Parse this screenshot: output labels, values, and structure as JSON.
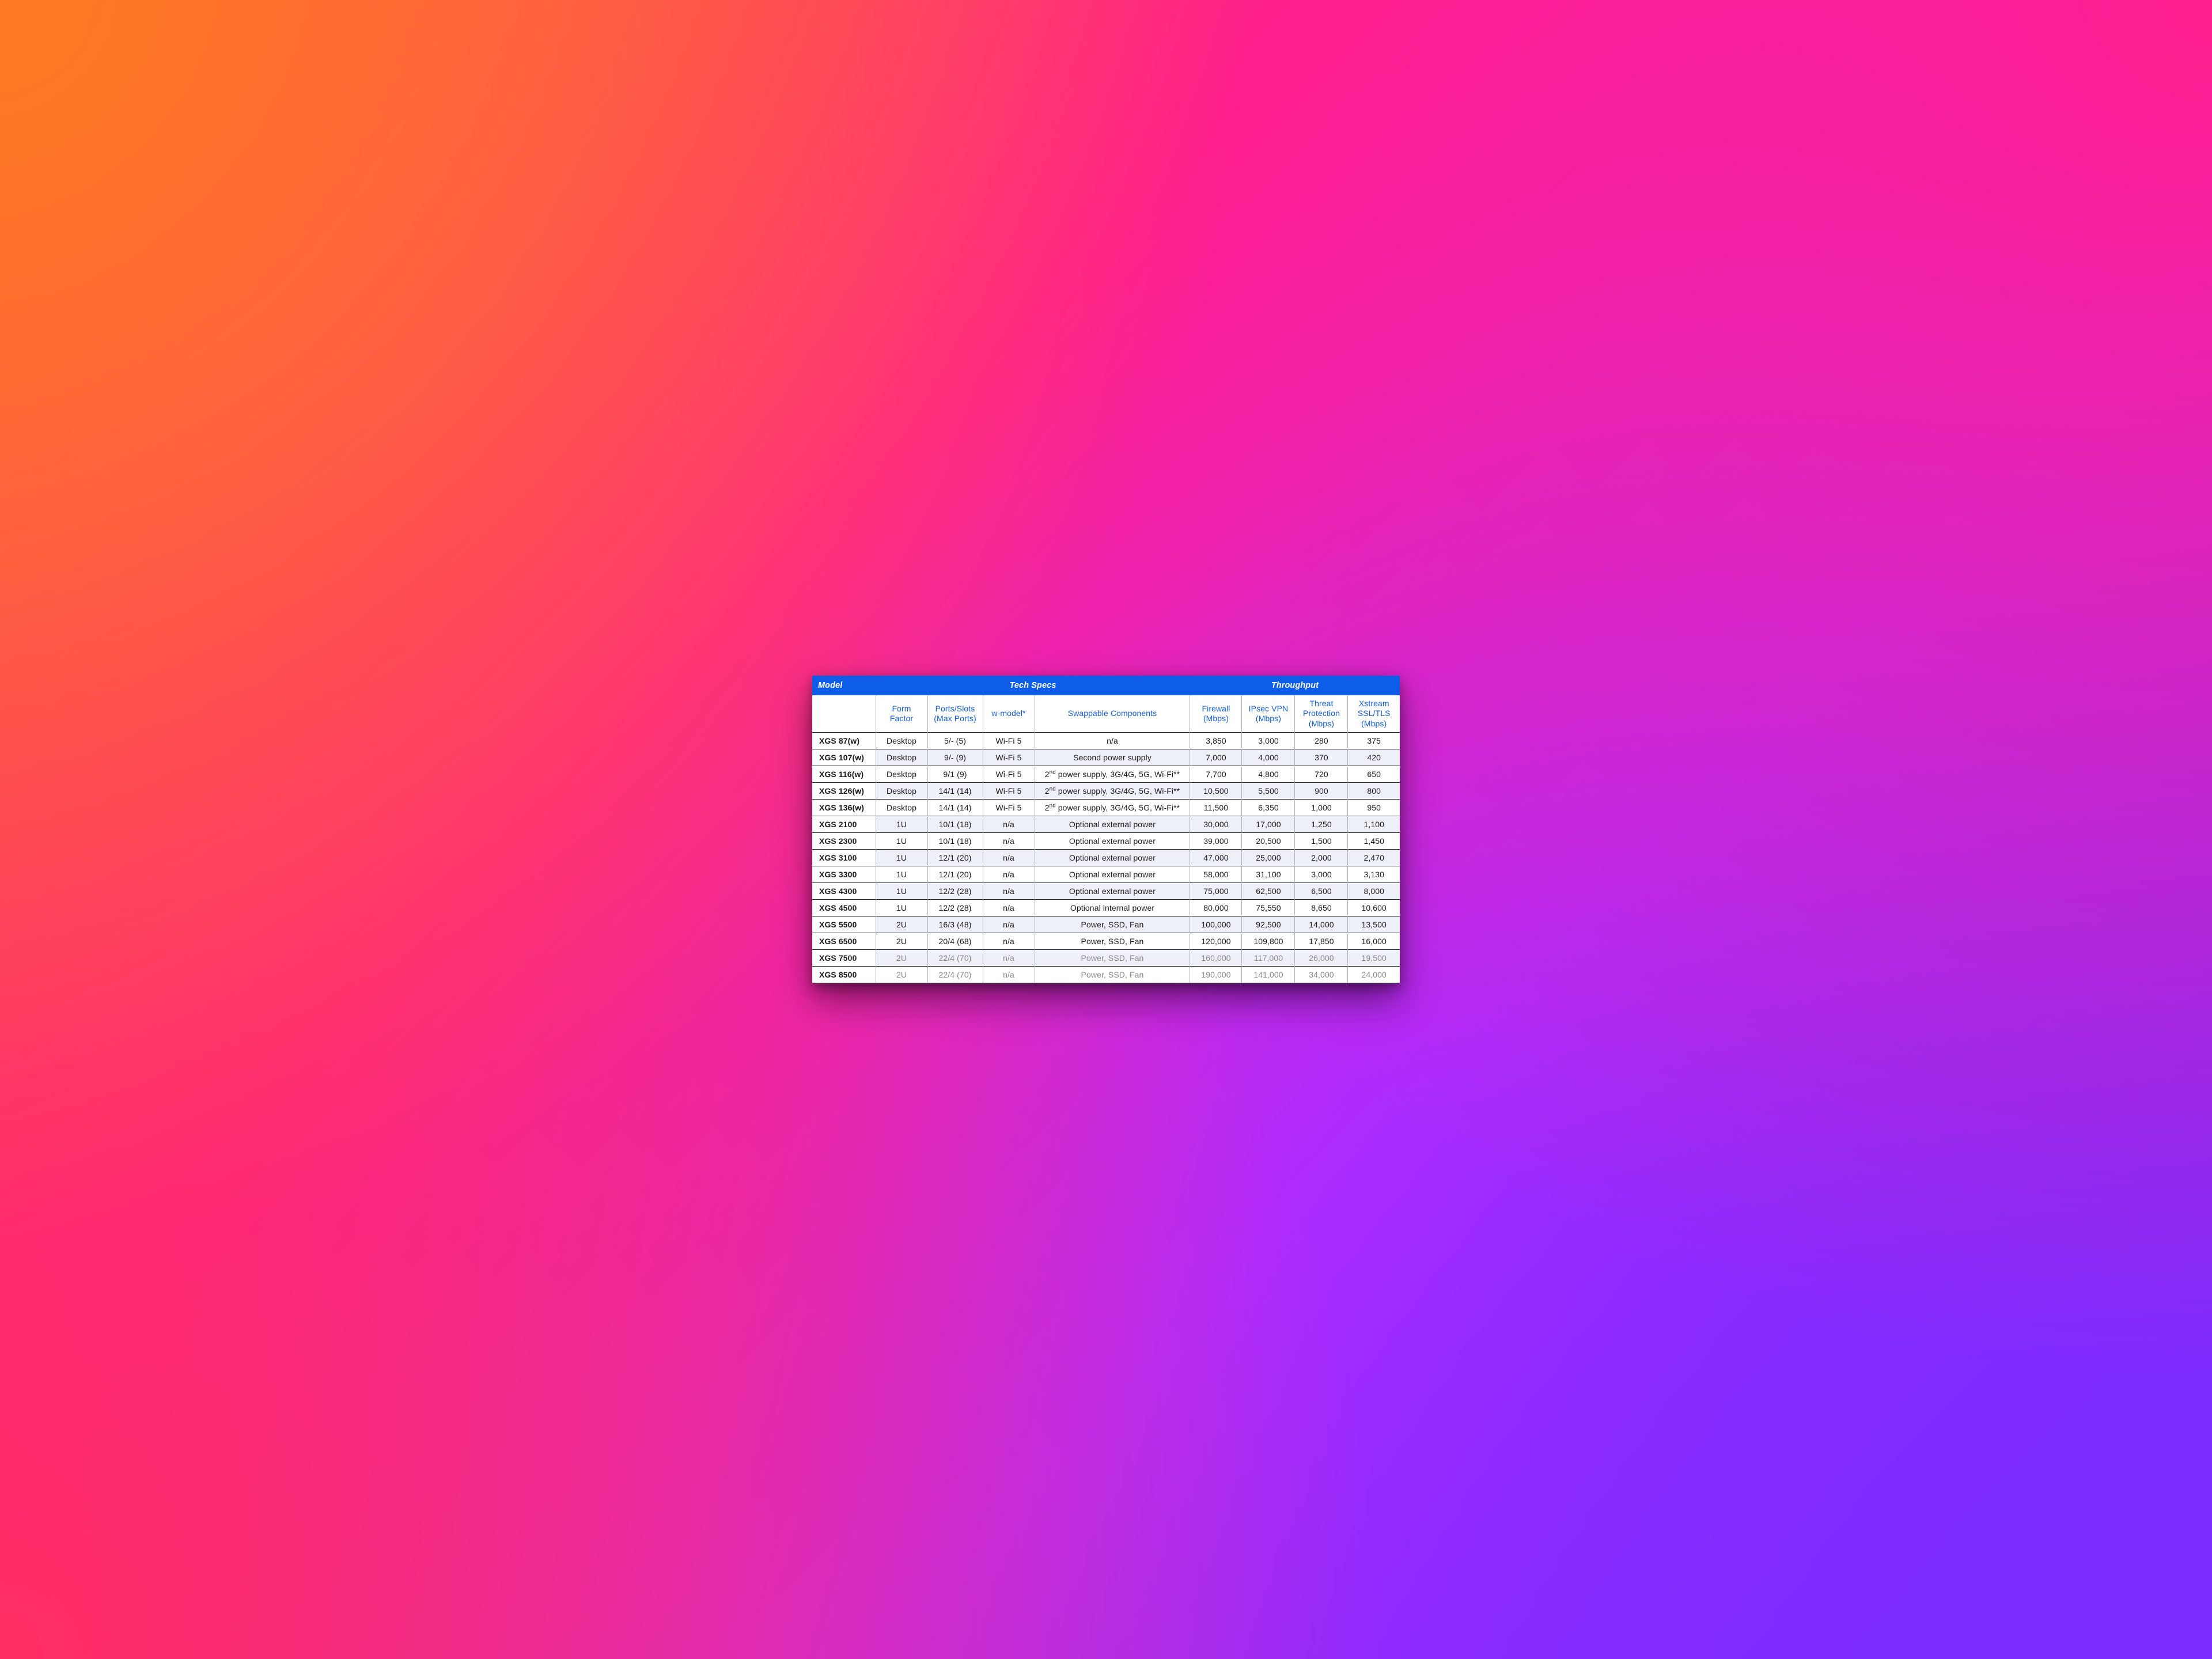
{
  "chart_data": {
    "type": "table",
    "title": "",
    "group_headers": [
      "Model",
      "Tech Specs",
      "Throughput"
    ],
    "columns": [
      "Model",
      "Form Factor",
      "Ports/Slots (Max Ports)",
      "w-model*",
      "Swappable Components",
      "Firewall (Mbps)",
      "IPsec VPN (Mbps)",
      "Threat Protection (Mbps)",
      "Xstream SSL/TLS (Mbps)"
    ],
    "rows": [
      [
        "XGS 87(w)",
        "Desktop",
        "5/- (5)",
        "Wi-Fi 5",
        "n/a",
        3850,
        3000,
        280,
        375
      ],
      [
        "XGS 107(w)",
        "Desktop",
        "9/- (9)",
        "Wi-Fi 5",
        "Second power supply",
        7000,
        4000,
        370,
        420
      ],
      [
        "XGS 116(w)",
        "Desktop",
        "9/1 (9)",
        "Wi-Fi 5",
        "2nd power supply, 3G/4G, 5G, Wi-Fi**",
        7700,
        4800,
        720,
        650
      ],
      [
        "XGS 126(w)",
        "Desktop",
        "14/1 (14)",
        "Wi-Fi 5",
        "2nd power supply, 3G/4G, 5G, Wi-Fi**",
        10500,
        5500,
        900,
        800
      ],
      [
        "XGS 136(w)",
        "Desktop",
        "14/1 (14)",
        "Wi-Fi 5",
        "2nd power supply, 3G/4G, 5G, Wi-Fi**",
        11500,
        6350,
        1000,
        950
      ],
      [
        "XGS 2100",
        "1U",
        "10/1 (18)",
        "n/a",
        "Optional external power",
        30000,
        17000,
        1250,
        1100
      ],
      [
        "XGS 2300",
        "1U",
        "10/1 (18)",
        "n/a",
        "Optional external power",
        39000,
        20500,
        1500,
        1450
      ],
      [
        "XGS 3100",
        "1U",
        "12/1 (20)",
        "n/a",
        "Optional external power",
        47000,
        25000,
        2000,
        2470
      ],
      [
        "XGS 3300",
        "1U",
        "12/1 (20)",
        "n/a",
        "Optional external power",
        58000,
        31100,
        3000,
        3130
      ],
      [
        "XGS 4300",
        "1U",
        "12/2 (28)",
        "n/a",
        "Optional external power",
        75000,
        62500,
        6500,
        8000
      ],
      [
        "XGS 4500",
        "1U",
        "12/2 (28)",
        "n/a",
        "Optional internal power",
        80000,
        75550,
        8650,
        10600
      ],
      [
        "XGS 5500",
        "2U",
        "16/3 (48)",
        "n/a",
        "Power, SSD, Fan",
        100000,
        92500,
        14000,
        13500
      ],
      [
        "XGS 6500",
        "2U",
        "20/4 (68)",
        "n/a",
        "Power, SSD, Fan",
        120000,
        109800,
        17850,
        16000
      ],
      [
        "XGS 7500",
        "2U",
        "22/4 (70)",
        "n/a",
        "Power, SSD, Fan",
        160000,
        117000,
        26000,
        19500
      ],
      [
        "XGS 8500",
        "2U",
        "22/4 (70)",
        "n/a",
        "Power, SSD, Fan",
        190000,
        141000,
        34000,
        24000
      ]
    ],
    "muted_rows": [
      13,
      14
    ]
  },
  "headers": {
    "model": "Model",
    "tech_specs": "Tech Specs",
    "throughput": "Throughput",
    "form_factor": "Form\nFactor",
    "ports": "Ports/Slots\n(Max Ports)",
    "w_model": "w-model*",
    "swap": "Swappable Components",
    "firewall": "Firewall\n(Mbps)",
    "ipsec": "IPsec VPN\n(Mbps)",
    "threat": "Threat\nProtection\n(Mbps)",
    "xstream": "Xstream\nSSL/TLS\n(Mbps)"
  }
}
